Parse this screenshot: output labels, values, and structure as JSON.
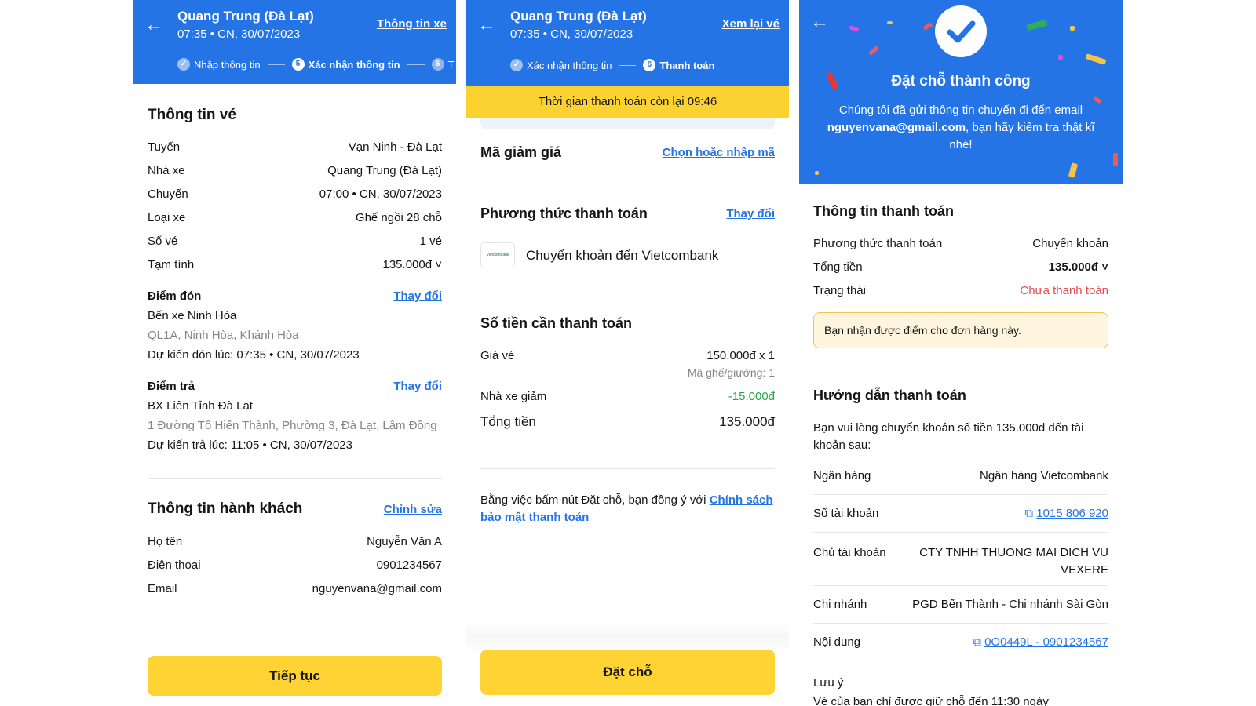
{
  "p1": {
    "title": "Quang Trung (Đà Lạt)",
    "sub": "07:35 • CN, 30/07/2023",
    "link": "Thông tin xe",
    "steps": [
      "Nhập thông tin",
      "Xác nhận thông tin",
      "T"
    ],
    "step_nums": [
      "5",
      "6"
    ],
    "ticket_title": "Thông tin vé",
    "rows": [
      {
        "k": "Tuyến",
        "v": "Vạn Ninh - Đà Lạt"
      },
      {
        "k": "Nhà xe",
        "v": "Quang Trung (Đà Lạt)"
      },
      {
        "k": "Chuyến",
        "v": "07:00 • CN, 30/07/2023"
      },
      {
        "k": "Loại xe",
        "v": "Ghế ngồi 28 chỗ"
      },
      {
        "k": "Số vé",
        "v": "1 vé"
      },
      {
        "k": "Tạm tính",
        "v": "135.000đ ˅"
      }
    ],
    "pickup": {
      "label": "Điểm đón",
      "change": "Thay đổi",
      "name": "Bến xe Ninh Hòa",
      "addr": "QL1A, Ninh Hòa, Khánh Hòa",
      "time": "Dự kiến đón lúc: 07:35 • CN, 30/07/2023"
    },
    "dropoff": {
      "label": "Điểm trả",
      "change": "Thay đổi",
      "name": "BX Liên Tỉnh Đà Lạt",
      "addr": "1 Đường Tô Hiến Thành, Phường 3, Đà Lạt, Lâm Đồng",
      "time": "Dự kiến trả lúc: 11:05 • CN, 30/07/2023"
    },
    "passenger_title": "Thông tin hành khách",
    "edit": "Chỉnh sửa",
    "passenger": [
      {
        "k": "Họ tên",
        "v": "Nguyễn Văn A"
      },
      {
        "k": "Điện thoại",
        "v": "0901234567"
      },
      {
        "k": "Email",
        "v": "nguyenvana@gmail.com"
      }
    ],
    "button": "Tiếp tục"
  },
  "p2": {
    "title": "Quang Trung (Đà Lạt)",
    "sub": "07:35 • CN, 30/07/2023",
    "link": "Xem lại vé",
    "steps": [
      "Xác nhận thông tin",
      "Thanh toán"
    ],
    "step_num": "6",
    "timer": "Thời gian thanh toán còn lại 09:46",
    "coupon": "Mã giảm giá",
    "coupon_link": "Chọn hoặc nhập mã",
    "method_title": "Phương thức thanh toán",
    "method_change": "Thay đổi",
    "method": "Chuyển khoản đến Vietcombank",
    "bank_logo": "Vietcombank",
    "amount_title": "Số tiền cần thanh toán",
    "price_k": "Giá vé",
    "price_v": "150.000đ x 1",
    "seat": "Mã ghế/giường: 1",
    "discount_k": "Nhà xe giảm",
    "discount_v": "-15.000đ",
    "total_k": "Tổng tiền",
    "total_v": "135.000đ",
    "terms": "Bằng việc bấm nút Đặt chỗ, bạn đồng ý với ",
    "terms_link": "Chính sách bảo mật thanh toán",
    "button": "Đặt chỗ"
  },
  "p3": {
    "success": "Đặt chỗ thành công",
    "msg1": "Chúng tôi đã gửi thông tin chuyến đi đến email",
    "email": "nguyenvana@gmail.com",
    "msg2": ", bạn hãy kiểm tra thật kĩ nhé!",
    "pay_title": "Thông tin thanh toán",
    "method_k": "Phương thức thanh toán",
    "method_v": "Chuyển khoản",
    "total_k": "Tổng tiền",
    "total_v": "135.000đ",
    "status_k": "Trạng thái",
    "status_v": "Chưa thanh toán",
    "notice": "Bạn nhận được điểm cho đơn hàng này.",
    "guide_title": "Hướng dẫn thanh toán",
    "guide_text": "Bạn vui lòng chuyển khoản số tiền 135.000đ đến tài khoản sau:",
    "bank_k": "Ngân hàng",
    "bank_v": "Ngân hàng Vietcombank",
    "acc_k": "Số tài khoản",
    "acc_v": "1015 806 920",
    "owner_k": "Chủ tài khoản",
    "owner_v": "CTY TNHH THUONG MAI DICH VU VEXERE",
    "branch_k": "Chi nhánh",
    "branch_v": "PGD Bến Thành - Chi nhánh Sài Gòn",
    "content_k": "Nội dung",
    "content_v": "0O0449L - 0901234567",
    "note_title": "Lưu ý",
    "note_text": "Vé của bạn chỉ được giữ chỗ đến 11:30 ngày"
  },
  "colors": {
    "primary": "#2474E5",
    "accent": "#FFD333",
    "success": "#27A745",
    "danger": "#E5484D"
  }
}
